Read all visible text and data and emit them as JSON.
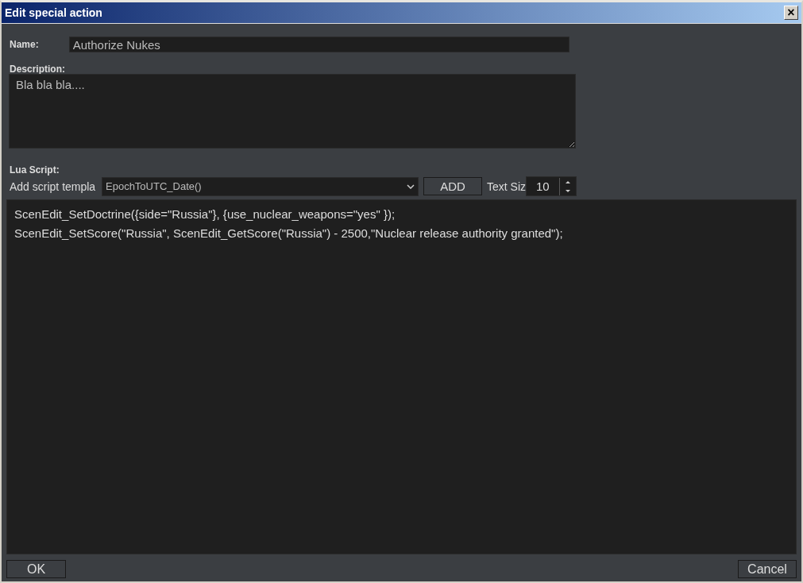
{
  "window": {
    "title": "Edit special action",
    "close": "×"
  },
  "name": {
    "label": "Name:",
    "value": "Authorize Nukes"
  },
  "description": {
    "label": "Description:",
    "value": "Bla bla bla...."
  },
  "lua_script": {
    "label": "Lua Script:",
    "template_label": "Add script templa",
    "template_value": "EpochToUTC_Date()",
    "add_button": "ADD",
    "text_size_label": "Text Siz",
    "text_size_value": "10",
    "lines": [
      "ScenEdit_SetDoctrine({side=\"Russia\"}, {use_nuclear_weapons=\"yes\" });",
      "ScenEdit_SetScore(\"Russia\", ScenEdit_GetScore(\"Russia\") - 2500,\"Nuclear release authority granted\");"
    ]
  },
  "buttons": [
    "OK",
    "Cancel"
  ]
}
